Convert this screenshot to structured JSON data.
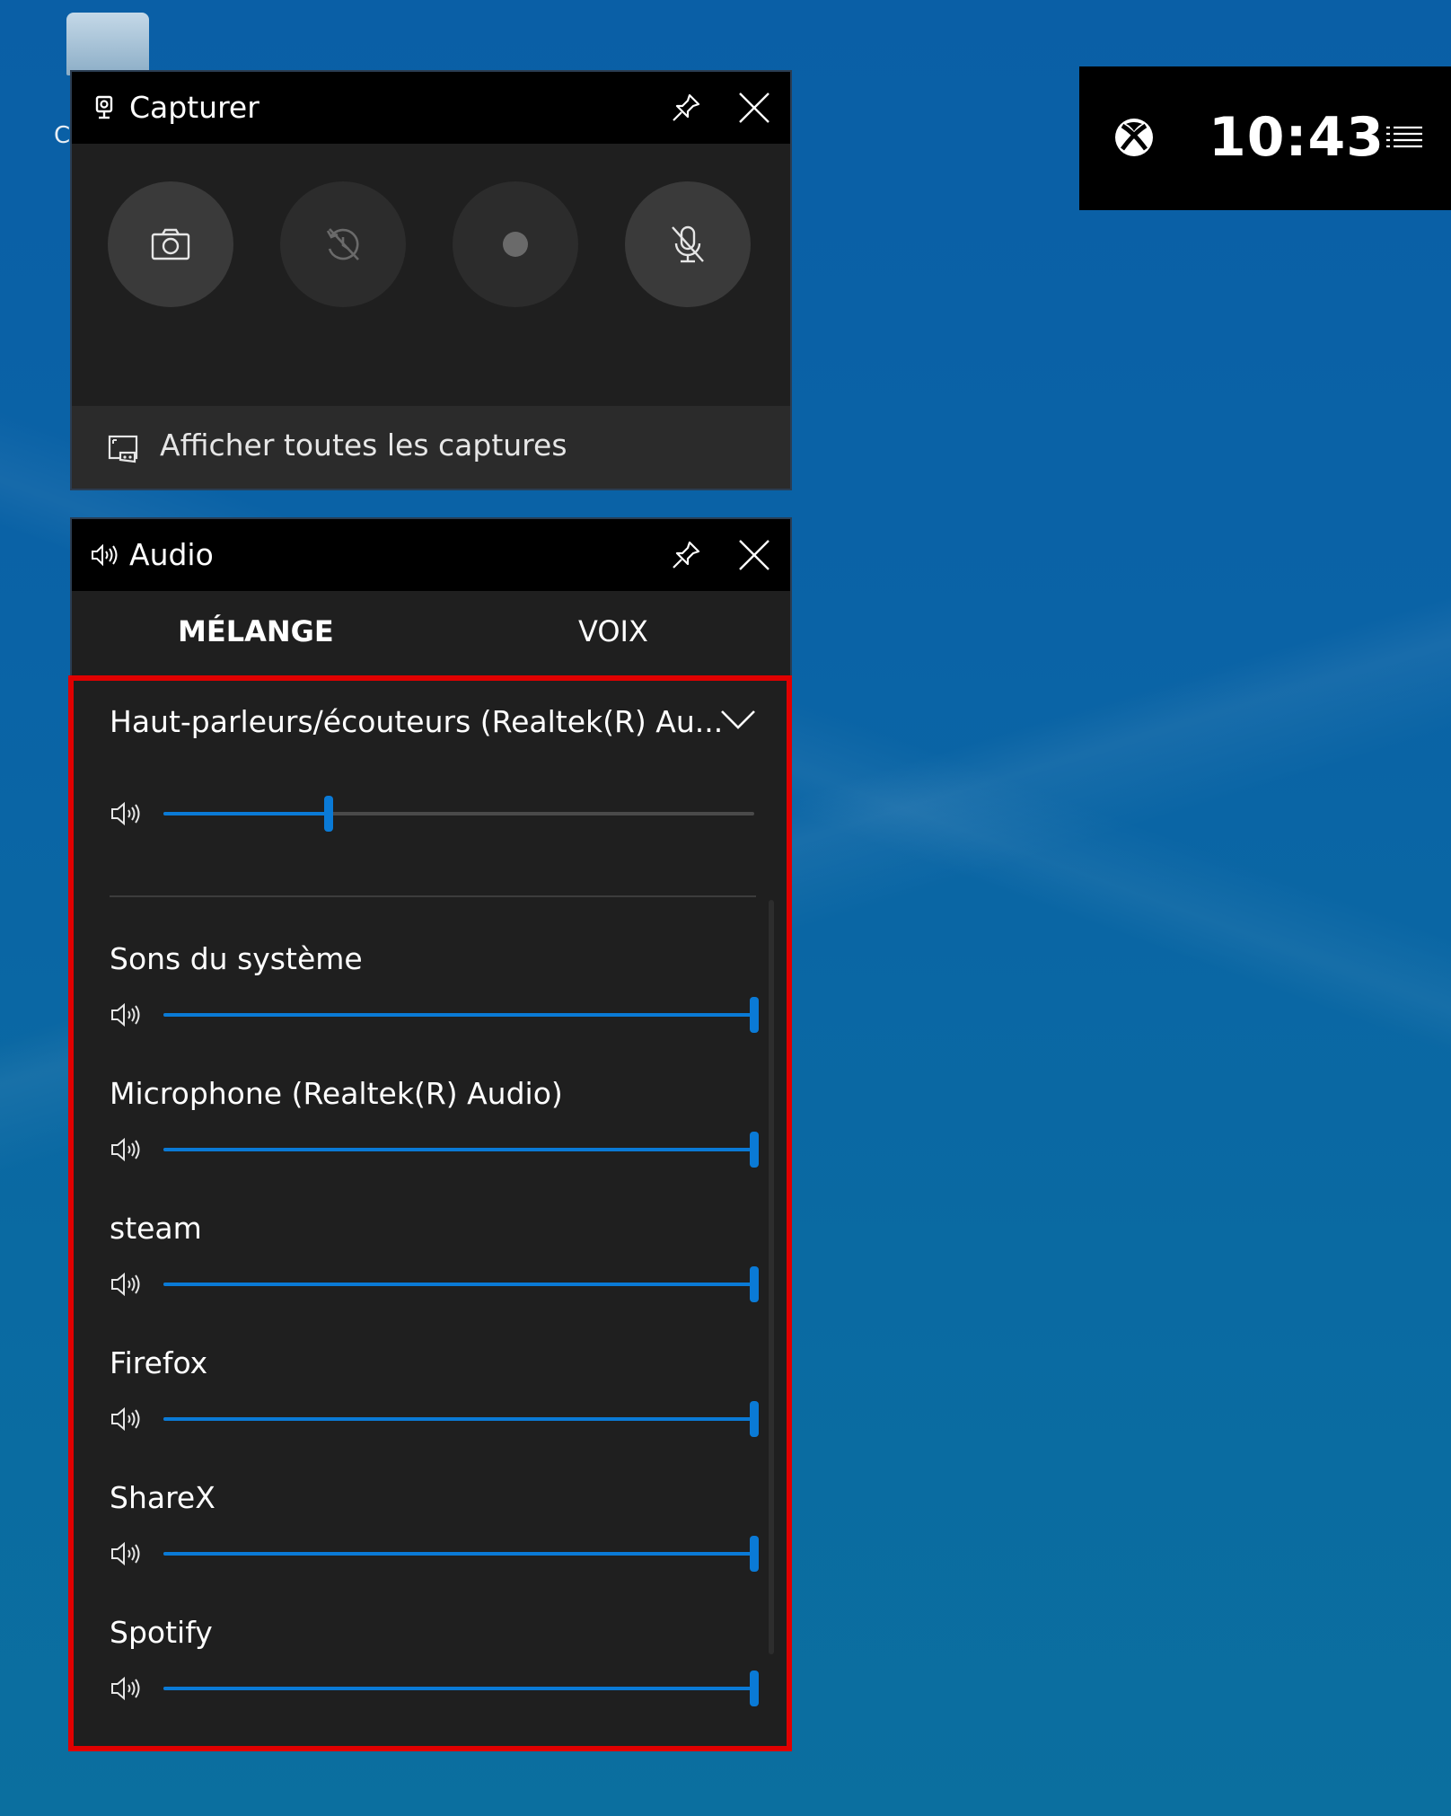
{
  "capture": {
    "title": "Capturer",
    "show_all_label": "Afficher toutes les captures"
  },
  "audio": {
    "title": "Audio",
    "tabs": [
      {
        "label": "MÉLANGE",
        "active": true
      },
      {
        "label": "VOIX",
        "active": false
      }
    ],
    "output_device": "Haut-parleurs/écouteurs (Realtek(R) Au...",
    "master_volume": 0.28,
    "apps": [
      {
        "name": "Sons du système",
        "volume": 1.0
      },
      {
        "name": "Microphone (Realtek(R) Audio)",
        "volume": 1.0
      },
      {
        "name": "steam",
        "volume": 1.0
      },
      {
        "name": "Firefox",
        "volume": 1.0
      },
      {
        "name": "ShareX",
        "volume": 1.0
      },
      {
        "name": "Spotify",
        "volume": 1.0
      }
    ]
  },
  "gamebar": {
    "time": "10:43"
  },
  "colors": {
    "accent": "#0a7ad6",
    "highlight_frame": "#e00000"
  }
}
